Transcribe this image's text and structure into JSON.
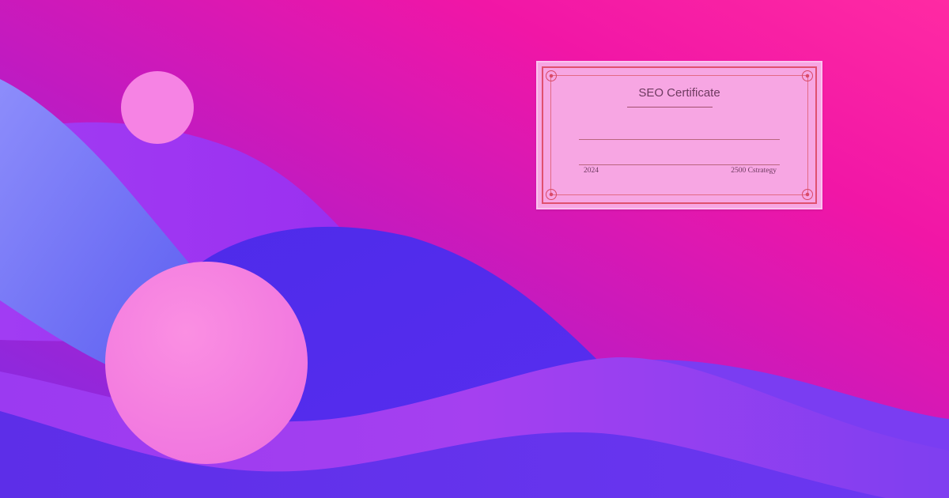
{
  "certificate": {
    "title": "SEO Certificate",
    "footer_left": "2024",
    "footer_right": "2500 Cstrategy"
  },
  "colors": {
    "background_magenta": "#f116a6",
    "background_purple": "#7a2ee8",
    "wave_violet": "#5b2ef0",
    "wave_blue": "#6a63f2",
    "circle_pink": "#f683e4",
    "certificate_paper": "#f7a6e3",
    "certificate_border": "#e0506e"
  }
}
